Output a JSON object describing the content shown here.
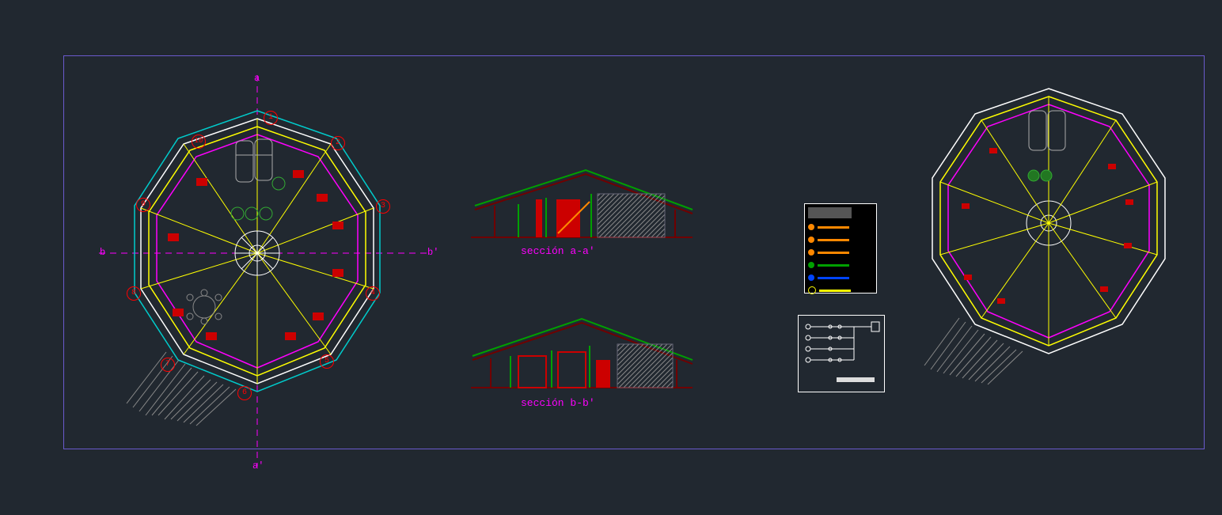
{
  "sections": {
    "a": "sección a-a'",
    "b": "sección b-b'"
  },
  "axis": {
    "a": "a",
    "a2": "a'",
    "b": "b",
    "b2": "b'"
  },
  "plan_numbers": [
    "1",
    "2",
    "3",
    "4",
    "5",
    "6",
    "7",
    "8",
    "9",
    "10"
  ],
  "colors": {
    "green": "#00a000",
    "red": "#cc0000",
    "darkred": "#700000",
    "magenta": "#ff00ff",
    "yellow": "#ffff00",
    "cyan": "#00cccc",
    "blue": "#0044ff",
    "white": "#ffffff",
    "orange": "#ff8800",
    "lime": "#33dd33"
  },
  "legend_colors": [
    "#ff8800",
    "#ff8800",
    "#ff8800",
    "#00a000",
    "#0044ff",
    "#ffff00"
  ]
}
